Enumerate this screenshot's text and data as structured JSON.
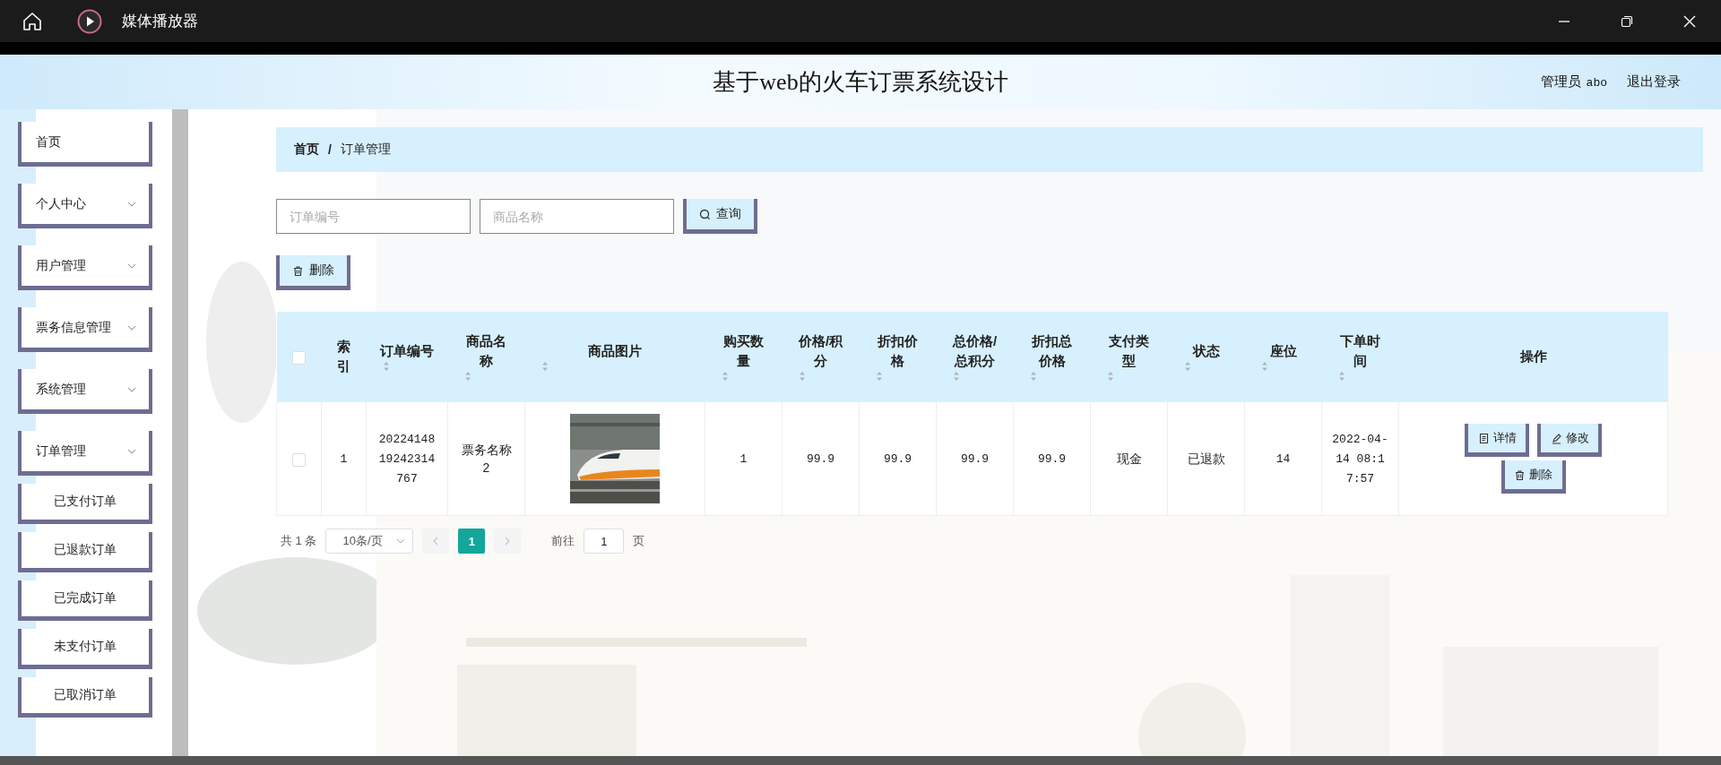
{
  "window": {
    "title": "媒体播放器"
  },
  "header": {
    "title": "基于web的火车订票系统设计",
    "role": "管理员",
    "username": "abo",
    "logout": "退出登录"
  },
  "sidebar": {
    "items": [
      {
        "label": "首页",
        "expandable": false
      },
      {
        "label": "个人中心",
        "expandable": true
      },
      {
        "label": "用户管理",
        "expandable": true
      },
      {
        "label": "票务信息管理",
        "expandable": true
      },
      {
        "label": "系统管理",
        "expandable": true
      },
      {
        "label": "订单管理",
        "expandable": true,
        "children": [
          {
            "label": "已支付订单"
          },
          {
            "label": "已退款订单"
          },
          {
            "label": "已完成订单"
          },
          {
            "label": "未支付订单"
          },
          {
            "label": "已取消订单"
          }
        ]
      }
    ]
  },
  "breadcrumb": {
    "items": [
      "首页",
      "订单管理"
    ],
    "separator": "/"
  },
  "search": {
    "fields": [
      {
        "placeholder": "订单编号"
      },
      {
        "placeholder": "商品名称"
      }
    ],
    "button": "查询"
  },
  "delete_button": "删除",
  "table": {
    "select_all": {
      "checked": false
    },
    "columns": [
      {
        "label": "索引",
        "sortable": false
      },
      {
        "label": "订单编号",
        "sortable": true
      },
      {
        "label": "商品名称",
        "sortable": true
      },
      {
        "label": "商品图片",
        "sortable": true
      },
      {
        "label": "购买数量",
        "sortable": true
      },
      {
        "label": "价格/积分",
        "sortable": true
      },
      {
        "label": "折扣价格",
        "sortable": true
      },
      {
        "label": "总价格/总积分",
        "sortable": true
      },
      {
        "label": "折扣总价格",
        "sortable": true
      },
      {
        "label": "支付类型",
        "sortable": true
      },
      {
        "label": "状态",
        "sortable": true
      },
      {
        "label": "座位",
        "sortable": true
      },
      {
        "label": "下单时间",
        "sortable": true
      },
      {
        "label": "操作",
        "sortable": false
      }
    ],
    "rows": [
      {
        "selected": false,
        "cells": [
          {
            "kind": "text",
            "text": "1"
          },
          {
            "kind": "text",
            "text": "2022414819242314767"
          },
          {
            "kind": "text",
            "text": "票务名称2"
          },
          {
            "kind": "picture"
          },
          {
            "kind": "text",
            "text": "1"
          },
          {
            "kind": "text",
            "text": "99.9"
          },
          {
            "kind": "text",
            "text": "99.9"
          },
          {
            "kind": "text",
            "text": "99.9"
          },
          {
            "kind": "text",
            "text": "99.9"
          },
          {
            "kind": "text",
            "text": "现金"
          },
          {
            "kind": "text",
            "text": "已退款"
          },
          {
            "kind": "text",
            "text": "14"
          },
          {
            "kind": "text",
            "text": "2022-04-14 08:17:57"
          },
          {
            "kind": "actions",
            "buttons": [
              {
                "kind": "detail",
                "label": "详情"
              },
              {
                "kind": "edit",
                "label": "修改"
              },
              {
                "kind": "delete",
                "label": "删除"
              }
            ]
          }
        ]
      }
    ]
  },
  "pagination": {
    "total": "共 1 条",
    "page_size": "10条/页",
    "pages": [
      {
        "label": "1",
        "selected": true
      }
    ],
    "goto_label": "前往",
    "goto_value": "1",
    "goto_suffix": "页"
  }
}
